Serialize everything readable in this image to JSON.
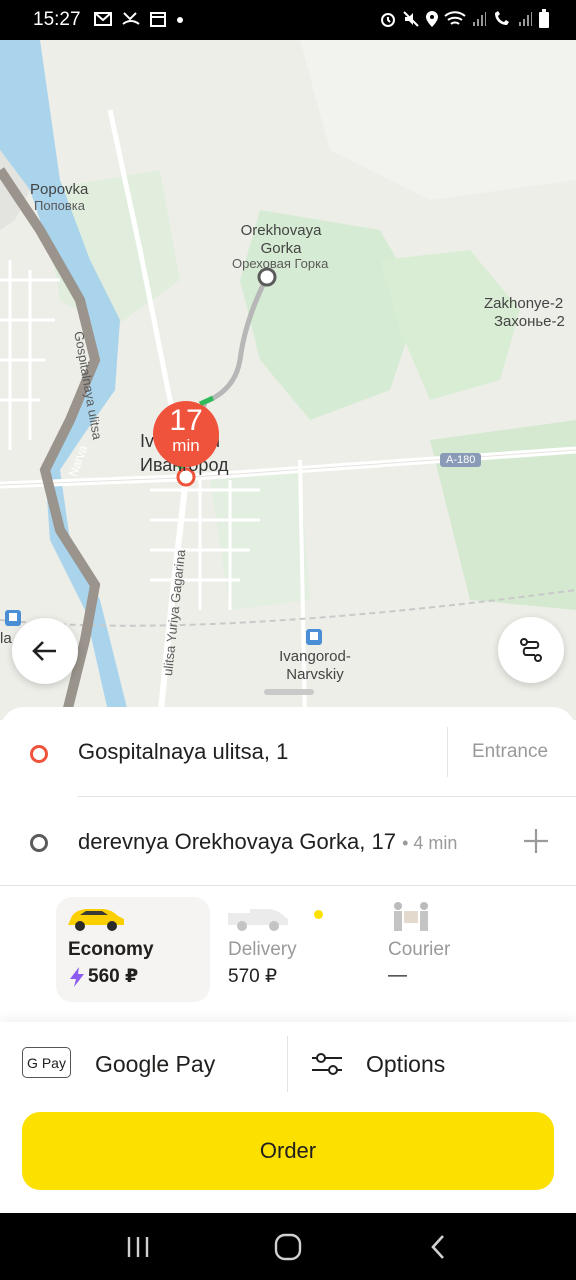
{
  "status_bar": {
    "time": "15:27",
    "left_icons": [
      "gmail-icon",
      "missed-call-icon",
      "calendar-icon",
      "dot-icon"
    ],
    "right_icons": [
      "alarm-icon",
      "mute-icon",
      "location-icon",
      "wifi-icon",
      "signal-icon",
      "wifi-calling-icon",
      "signal-icon",
      "battery-icon"
    ]
  },
  "map": {
    "labels": [
      {
        "id": "popovka-en",
        "text": "Popovka"
      },
      {
        "id": "popovka-ru",
        "text": "Поповка"
      },
      {
        "id": "orekhovaya-en",
        "text": "Orekhovaya Gorka"
      },
      {
        "id": "orekhovaya-ru",
        "text": "Ореховая Горка"
      },
      {
        "id": "zakhonye-en",
        "text": "Zakhonye-2"
      },
      {
        "id": "zakhonye-ru",
        "text": "Захонье-2"
      },
      {
        "id": "gospitalnaya-street",
        "text": "Gospitalnaya ulitsa"
      },
      {
        "id": "narva",
        "text": "Narva"
      },
      {
        "id": "ivangorod-en",
        "text": "Ivangorod"
      },
      {
        "id": "ivangorod-ru",
        "text": "Ивангород"
      },
      {
        "id": "gagarina-street",
        "text": "ulitsa Yuriya Gagarina"
      },
      {
        "id": "station",
        "text": "Ivangorod-Narvskiy"
      },
      {
        "id": "edge-fragment",
        "text": "la"
      }
    ],
    "road_badge": "A-180",
    "eta": {
      "value": "17",
      "unit": "min"
    },
    "back_button_icon": "arrow-left-icon",
    "route_button_icon": "route-icon"
  },
  "addresses": {
    "from": {
      "text": "Gospitalnaya ulitsa, 1",
      "action": "Entrance"
    },
    "to": {
      "text": "derevnya Orekhovaya Gorka, 17",
      "sub": "• 4 min",
      "action_icon": "plus-icon"
    }
  },
  "tariffs": [
    {
      "name": "Economy",
      "price": "560 ₽",
      "icon": "lightning-icon",
      "selected": true
    },
    {
      "name": "Delivery",
      "price": "570 ₽",
      "selected": false
    },
    {
      "name": "Courier",
      "price": "—",
      "selected": false
    }
  ],
  "payment": {
    "badge": "G Pay",
    "label": "Google Pay"
  },
  "options": {
    "label": "Options"
  },
  "order_button": {
    "label": "Order"
  },
  "colors": {
    "accent_yellow": "#fce000",
    "route_red": "#f0533b",
    "point_gray": "#5b5b5b"
  }
}
